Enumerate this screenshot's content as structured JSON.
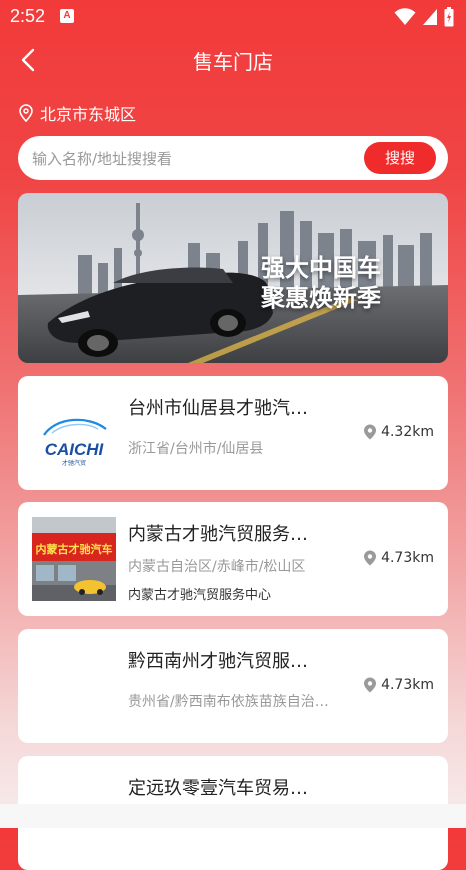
{
  "status": {
    "time": "2:52",
    "a_label": "A"
  },
  "header": {
    "title": "售车门店"
  },
  "location": {
    "text": "北京市东城区",
    "icon": "location-pin-icon"
  },
  "search": {
    "placeholder": "输入名称/地址搜搜看",
    "button_label": "搜搜"
  },
  "banner": {
    "line1": "强大中国车",
    "line2": "聚惠焕新季"
  },
  "stores": [
    {
      "name": "台州市仙居县才驰汽…",
      "region": "浙江省/台州市/仙居县",
      "subtitle": "",
      "distance": "4.32km",
      "logo": "caichi-logo",
      "logo_text": "CAICHI",
      "logo_sub": "才驰汽贸"
    },
    {
      "name": "内蒙古才驰汽贸服务…",
      "region": "内蒙古自治区/赤峰市/松山区",
      "subtitle": "内蒙古才驰汽贸服务中心",
      "distance": "4.73km",
      "logo": "store-photo",
      "sign_text": "内蒙古才驰汽车"
    },
    {
      "name": "黔西南州才驰汽贸服…",
      "region": "贵州省/黔西南布依族苗族自治…",
      "subtitle": "",
      "distance": "4.73km",
      "logo": "none"
    },
    {
      "name": "定远玖零壹汽车贸易…",
      "region": "",
      "subtitle": "",
      "distance": "",
      "logo": "caichi-logo-partial"
    }
  ],
  "colors": {
    "brand_red": "#ef2b2b",
    "text_dark": "#222222",
    "text_gray": "#999999"
  }
}
